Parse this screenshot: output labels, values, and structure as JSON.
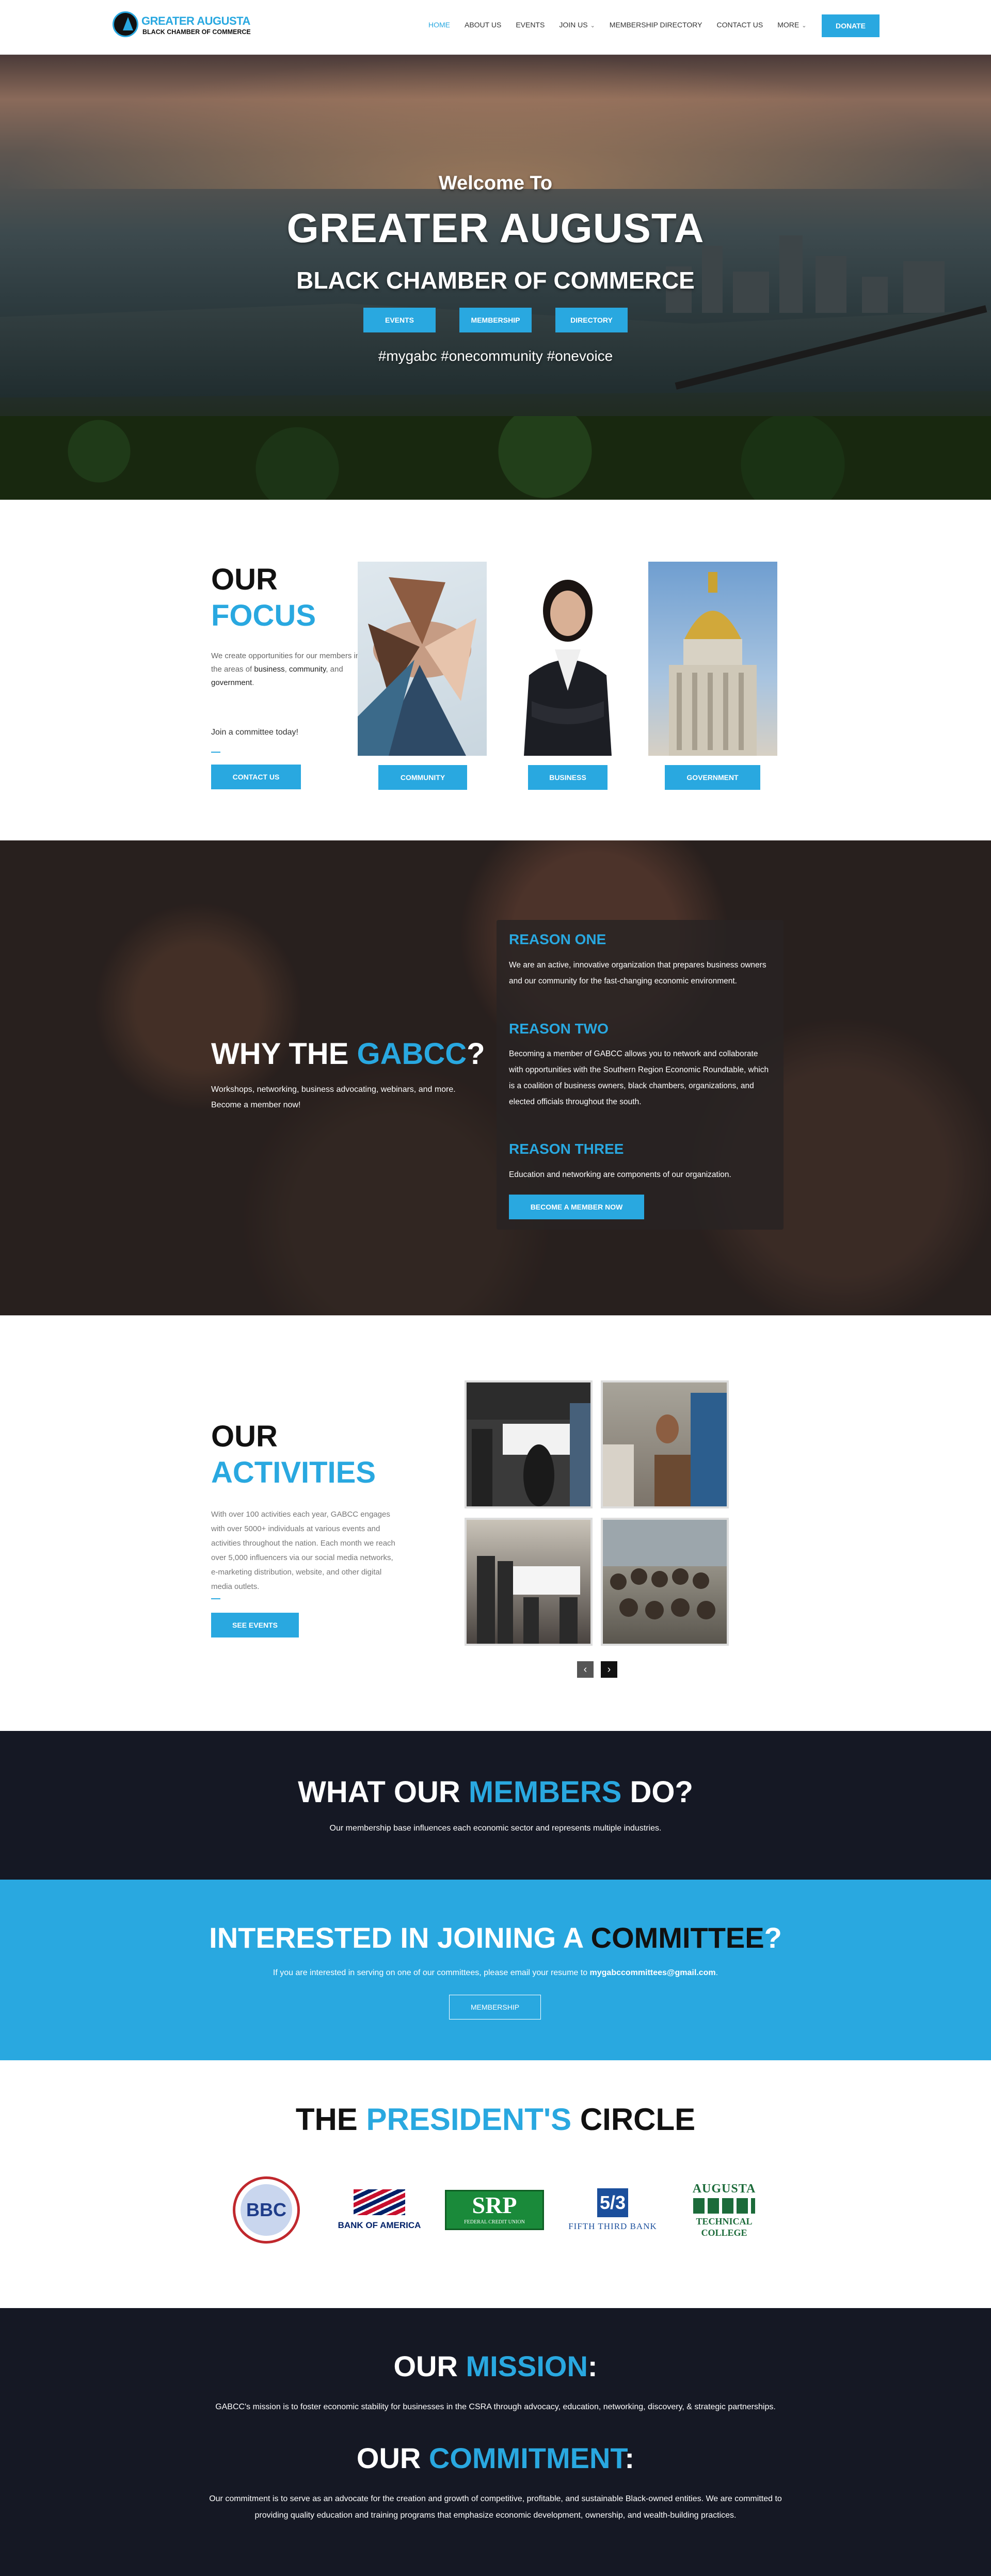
{
  "brand": {
    "line1": "GREATER AUGUSTA",
    "line2": "BLACK CHAMBER OF COMMERCE",
    "accent": "#29a8e0",
    "dark": "#151824"
  },
  "nav": {
    "items": [
      {
        "label": "HOME",
        "active": true
      },
      {
        "label": "ABOUT US"
      },
      {
        "label": "EVENTS"
      },
      {
        "label": "JOIN US",
        "dropdown": true
      },
      {
        "label": "MEMBERSHIP DIRECTORY"
      },
      {
        "label": "CONTACT US"
      },
      {
        "label": "MORE",
        "dropdown": true
      }
    ],
    "donate": "DONATE"
  },
  "hero": {
    "welcome": "Welcome To",
    "title": "GREATER AUGUSTA",
    "subtitle": "BLACK CHAMBER OF COMMERCE",
    "buttons": [
      "EVENTS",
      "MEMBERSHIP",
      "DIRECTORY"
    ],
    "hashtags": "#mygabc #onecommunity #onevoice"
  },
  "focus": {
    "heading_dark": "OUR",
    "heading_blue": "FOCUS",
    "text_pre": "We create opportunities for our members in the areas of ",
    "text_b1": "business",
    "text_mid1": ", ",
    "text_b2": "community",
    "text_mid2": ", and ",
    "text_b3": "government",
    "text_end": ".",
    "join": "Join a committee today!",
    "contact_btn": "CONTACT US",
    "cards": [
      "COMMUNITY",
      "BUSINESS",
      "GOVERNMENT"
    ]
  },
  "why": {
    "heading_pre": "WHY THE ",
    "heading_blue": "GABCC",
    "heading_post": "?",
    "text": "Workshops, networking, business advocating, webinars, and more. Become a member now!",
    "reasons": [
      {
        "title": "REASON ONE",
        "text": "We are an active, innovative organization that prepares business owners and our community for the fast-changing economic environment."
      },
      {
        "title": "REASON TWO",
        "text": "Becoming a member of GABCC allows you to network and collaborate with opportunities with the Southern Region Economic Roundtable, which is a coalition of business owners, black chambers, organizations, and elected officials throughout the south."
      },
      {
        "title": "REASON THREE",
        "text": "Education and networking are components of our organization."
      }
    ],
    "button": "BECOME A MEMBER NOW"
  },
  "activities": {
    "heading_dark": "OUR",
    "heading_blue": "ACTIVITIES",
    "text": "With over 100 activities each year, GABCC engages with over 5000+ individuals at various events and activities throughout the nation. Each month we reach over 5,000 influencers via our social media networks, e-marketing distribution, website, and other digital media outlets.",
    "button": "SEE EVENTS",
    "prev": "‹",
    "next": "›"
  },
  "members": {
    "heading_pre": "WHAT OUR ",
    "heading_blue": "MEMBERS",
    "heading_post": " DO?",
    "text": "Our membership base influences each economic sector and represents multiple industries."
  },
  "committee": {
    "heading_pre": "INTERESTED IN JOINING A ",
    "heading_dark": "COMMITTEE",
    "heading_post": "?",
    "text_pre": "If you are interested in serving on one of our committees, please email your resume to ",
    "email": "mygabccommittees@gmail.com",
    "text_end": ".",
    "button": "MEMBERSHIP"
  },
  "president": {
    "heading_pre": "THE ",
    "heading_blue": "PRESIDENT'S",
    "heading_post": " CIRCLE",
    "logos": {
      "bbc": "BBC",
      "boa": "BANK OF AMERICA",
      "srp": "SRP",
      "srp_sub": "FEDERAL CREDIT UNION",
      "fifth": "FIFTH THIRD BANK",
      "atc_1": "AUGUSTA",
      "atc_2": "TECHNICAL",
      "atc_3": "COLLEGE"
    }
  },
  "mission": {
    "heading_pre": "OUR ",
    "heading_blue": "MISSION",
    "heading_post": ":",
    "text": "GABCC's mission is to foster economic stability for businesses in the CSRA through advocacy, education, networking, discovery, & strategic partnerships.",
    "commit_pre": "OUR ",
    "commit_blue": "COMMITMENT",
    "commit_post": ":",
    "commit_text": "Our commitment is to serve as an advocate for the creation and growth of competitive, profitable, and sustainable Black-owned entities. We are committed to providing quality education and training programs that emphasize economic development, ownership, and wealth-building practices."
  }
}
